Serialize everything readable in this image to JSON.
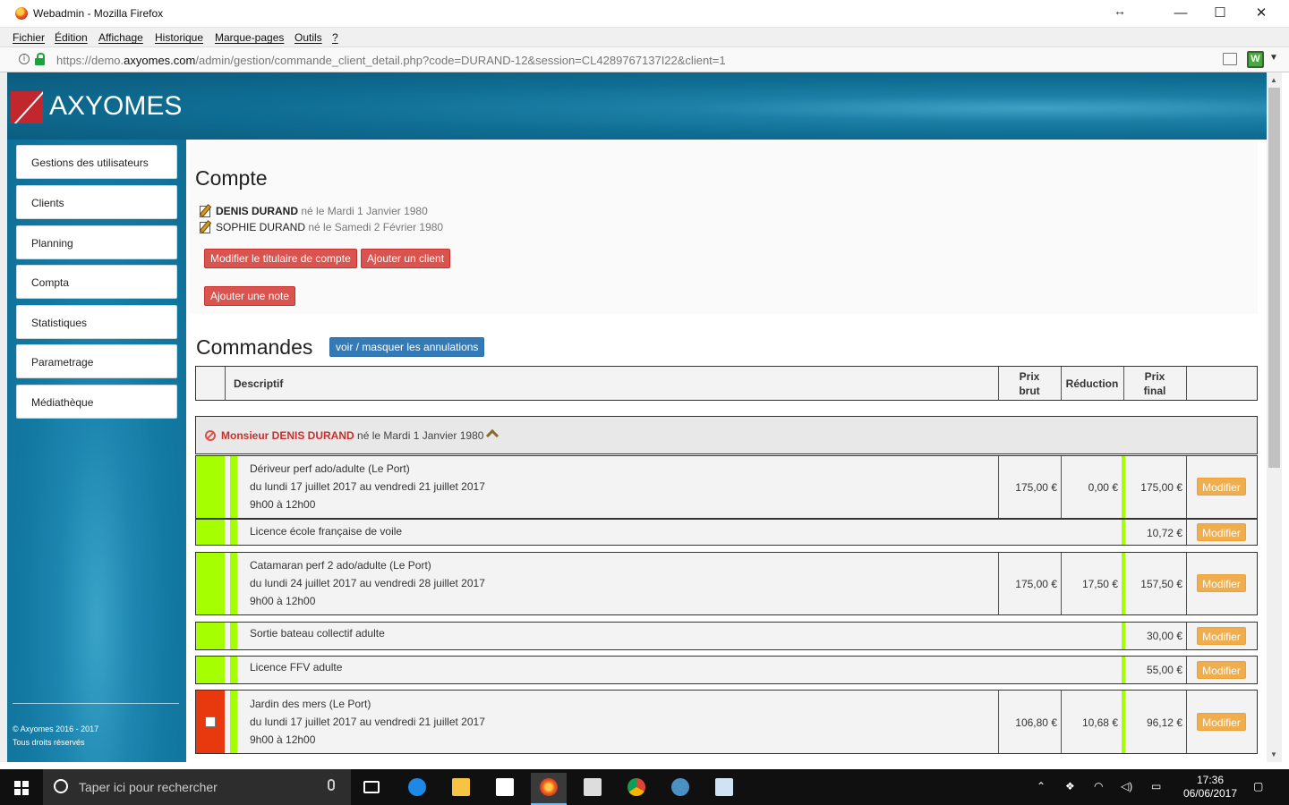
{
  "window": {
    "title": "Webadmin - Mozilla Firefox",
    "minimize": "—",
    "maximize": "☐",
    "close": "✕"
  },
  "menu": [
    "Fichier",
    "Édition",
    "Affichage",
    "Historique",
    "Marque-pages",
    "Outils",
    "?"
  ],
  "urlbar": {
    "prefix": "https://demo.",
    "domain": "axyomes.com",
    "path": "/admin/gestion/commande_client_detail.php?code=DURAND-12&session=CL4289767137I22&client=1"
  },
  "brand": {
    "name": "AXYOMES",
    "color": "#c1272d"
  },
  "sidebar": {
    "items": [
      "Gestions des utilisateurs",
      "Clients",
      "Planning",
      "Compta",
      "Statistiques",
      "Parametrage",
      "Médiathèque"
    ],
    "footer_line1": "© Axyomes 2016 - 2017",
    "footer_line2": "Tous droits réservés"
  },
  "compte": {
    "title": "Compte",
    "persons": [
      {
        "name": "DENIS DURAND",
        "born": "né le Mardi 1 Janvier 1980"
      },
      {
        "name": "SOPHIE DURAND",
        "born": "né le Samedi 2 Février 1980"
      }
    ],
    "buttons": {
      "modify_holder": "Modifier le titulaire de compte",
      "add_client": "Ajouter un client",
      "add_note": "Ajouter une note"
    }
  },
  "commandes": {
    "title": "Commandes",
    "toggle_label": "voir / masquer les annulations",
    "headers": {
      "descriptif": "Descriptif",
      "prix_brut_1": "Prix",
      "prix_brut_2": "brut",
      "reduction": "Réduction",
      "prix_final_1": "Prix",
      "prix_final_2": "final"
    },
    "group": {
      "who": "Monsieur DENIS DURAND",
      "born": "né le Mardi 1 Janvier 1980"
    },
    "modify_label": "Modifier",
    "rows": [
      {
        "l1": "Dériveur perf ado/adulte (Le Port)",
        "l2": "du lundi 17 juillet 2017 au vendredi 21 juillet 2017",
        "l3": "9h00 à 12h00",
        "brut": "175,00 €",
        "red": "0,00 €",
        "final": "175,00 €"
      },
      {
        "l1": "Licence école française de voile",
        "final": "10,72 €"
      },
      {
        "l1": "Catamaran perf 2 ado/adulte (Le Port)",
        "l2": "du lundi 24 juillet 2017 au vendredi 28 juillet 2017",
        "l3": "9h00 à 12h00",
        "brut": "175,00 €",
        "red": "17,50 €",
        "final": "157,50 €"
      },
      {
        "l1": "Sortie bateau collectif adulte",
        "final": "30,00 €"
      },
      {
        "l1": "Licence FFV adulte",
        "final": "55,00 €"
      },
      {
        "l1": "Jardin des mers (Le Port)",
        "l2": "du lundi 17 juillet 2017 au vendredi 21 juillet 2017",
        "l3": "9h00 à 12h00",
        "brut": "106,80 €",
        "red": "10,68 €",
        "final": "96,12 €"
      }
    ],
    "status_colors": {
      "ok": "#a6ff00",
      "cancelled": "#e8380d"
    }
  },
  "taskbar": {
    "search_placeholder": "Taper ici pour rechercher",
    "time": "17:36",
    "date": "06/06/2017"
  }
}
